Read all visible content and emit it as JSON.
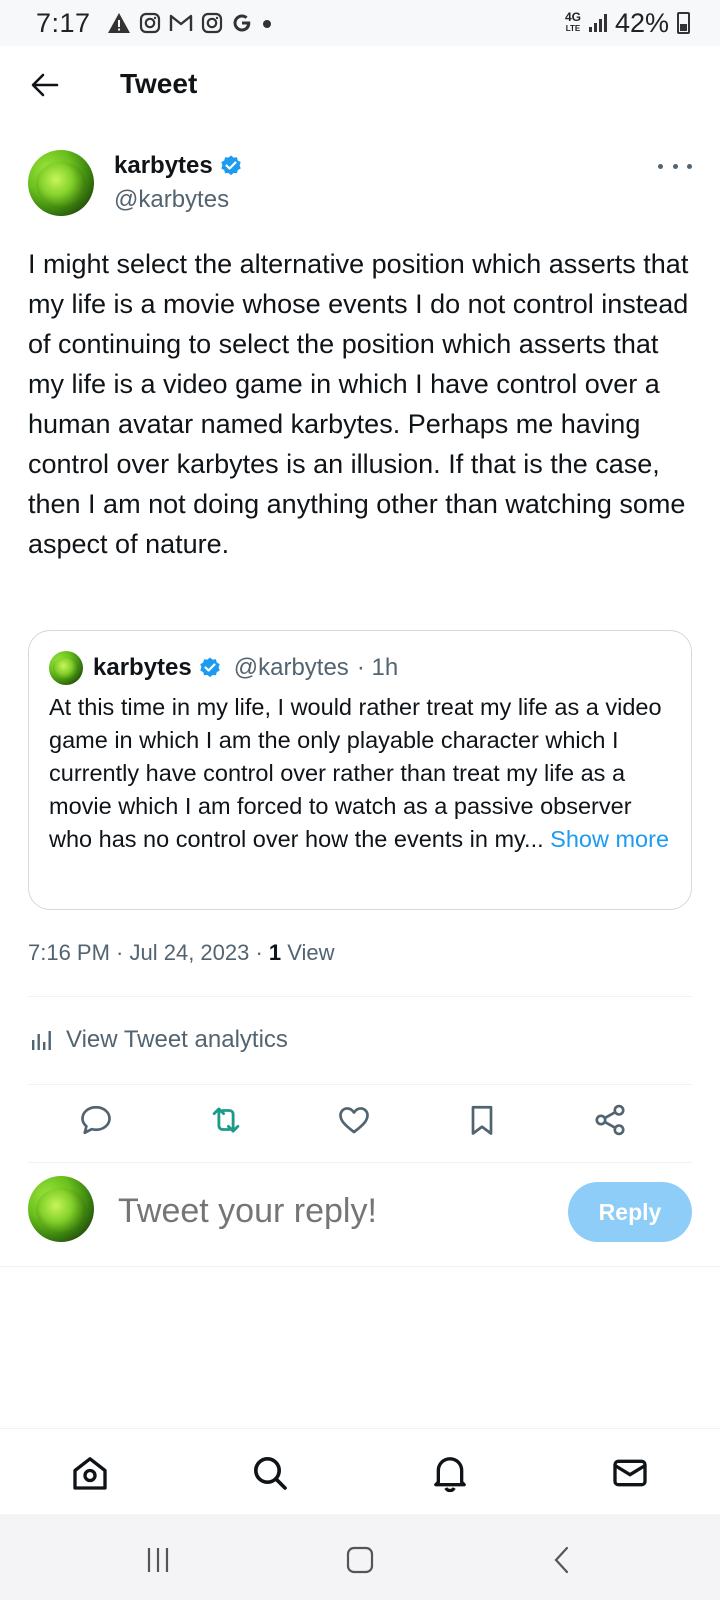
{
  "status_bar": {
    "time": "7:17",
    "notification_icons": [
      "warning-icon",
      "instagram-icon",
      "gmail-icon",
      "instagram-icon",
      "google-icon",
      "dot-icon"
    ],
    "network": "4G LTE",
    "battery": "42%"
  },
  "header": {
    "title": "Tweet"
  },
  "tweet": {
    "author_name": "karbytes",
    "author_handle": "@karbytes",
    "text": "I might select the alternative position which asserts that my life is a movie whose events I do not control instead of continuing to select the position which asserts that my life is a video game in which I have control over a human avatar named karbytes. Perhaps me having control over karbytes is an illusion. If that is the case, then I am not doing anything other than watching some aspect of nature.",
    "quoted": {
      "author_name": "karbytes",
      "author_handle": "@karbytes",
      "time": "· 1h",
      "text": "At this time in my life, I would rather treat my life as a video game in which I am the only playable character which I currently have control over rather than treat my life as a movie which I am forced to watch as a passive observer who has no control over how the events in my...",
      "show_more": "Show more"
    },
    "timestamp": "7:16 PM · Jul 24, 2023 · ",
    "view_count": "1",
    "view_label": " View"
  },
  "analytics": {
    "label": "View Tweet analytics"
  },
  "actions": [
    "reply-icon",
    "retweet-icon",
    "like-icon",
    "bookmark-icon",
    "share-icon"
  ],
  "reply_composer": {
    "placeholder": "Tweet your reply!",
    "button_label": "Reply"
  },
  "bottom_nav": [
    "home-icon",
    "search-icon",
    "notifications-icon",
    "messages-icon"
  ],
  "colors": {
    "accent": "#1d9bf0",
    "reply_button_disabled": "#8ecdf8",
    "secondary_text": "#536471"
  }
}
